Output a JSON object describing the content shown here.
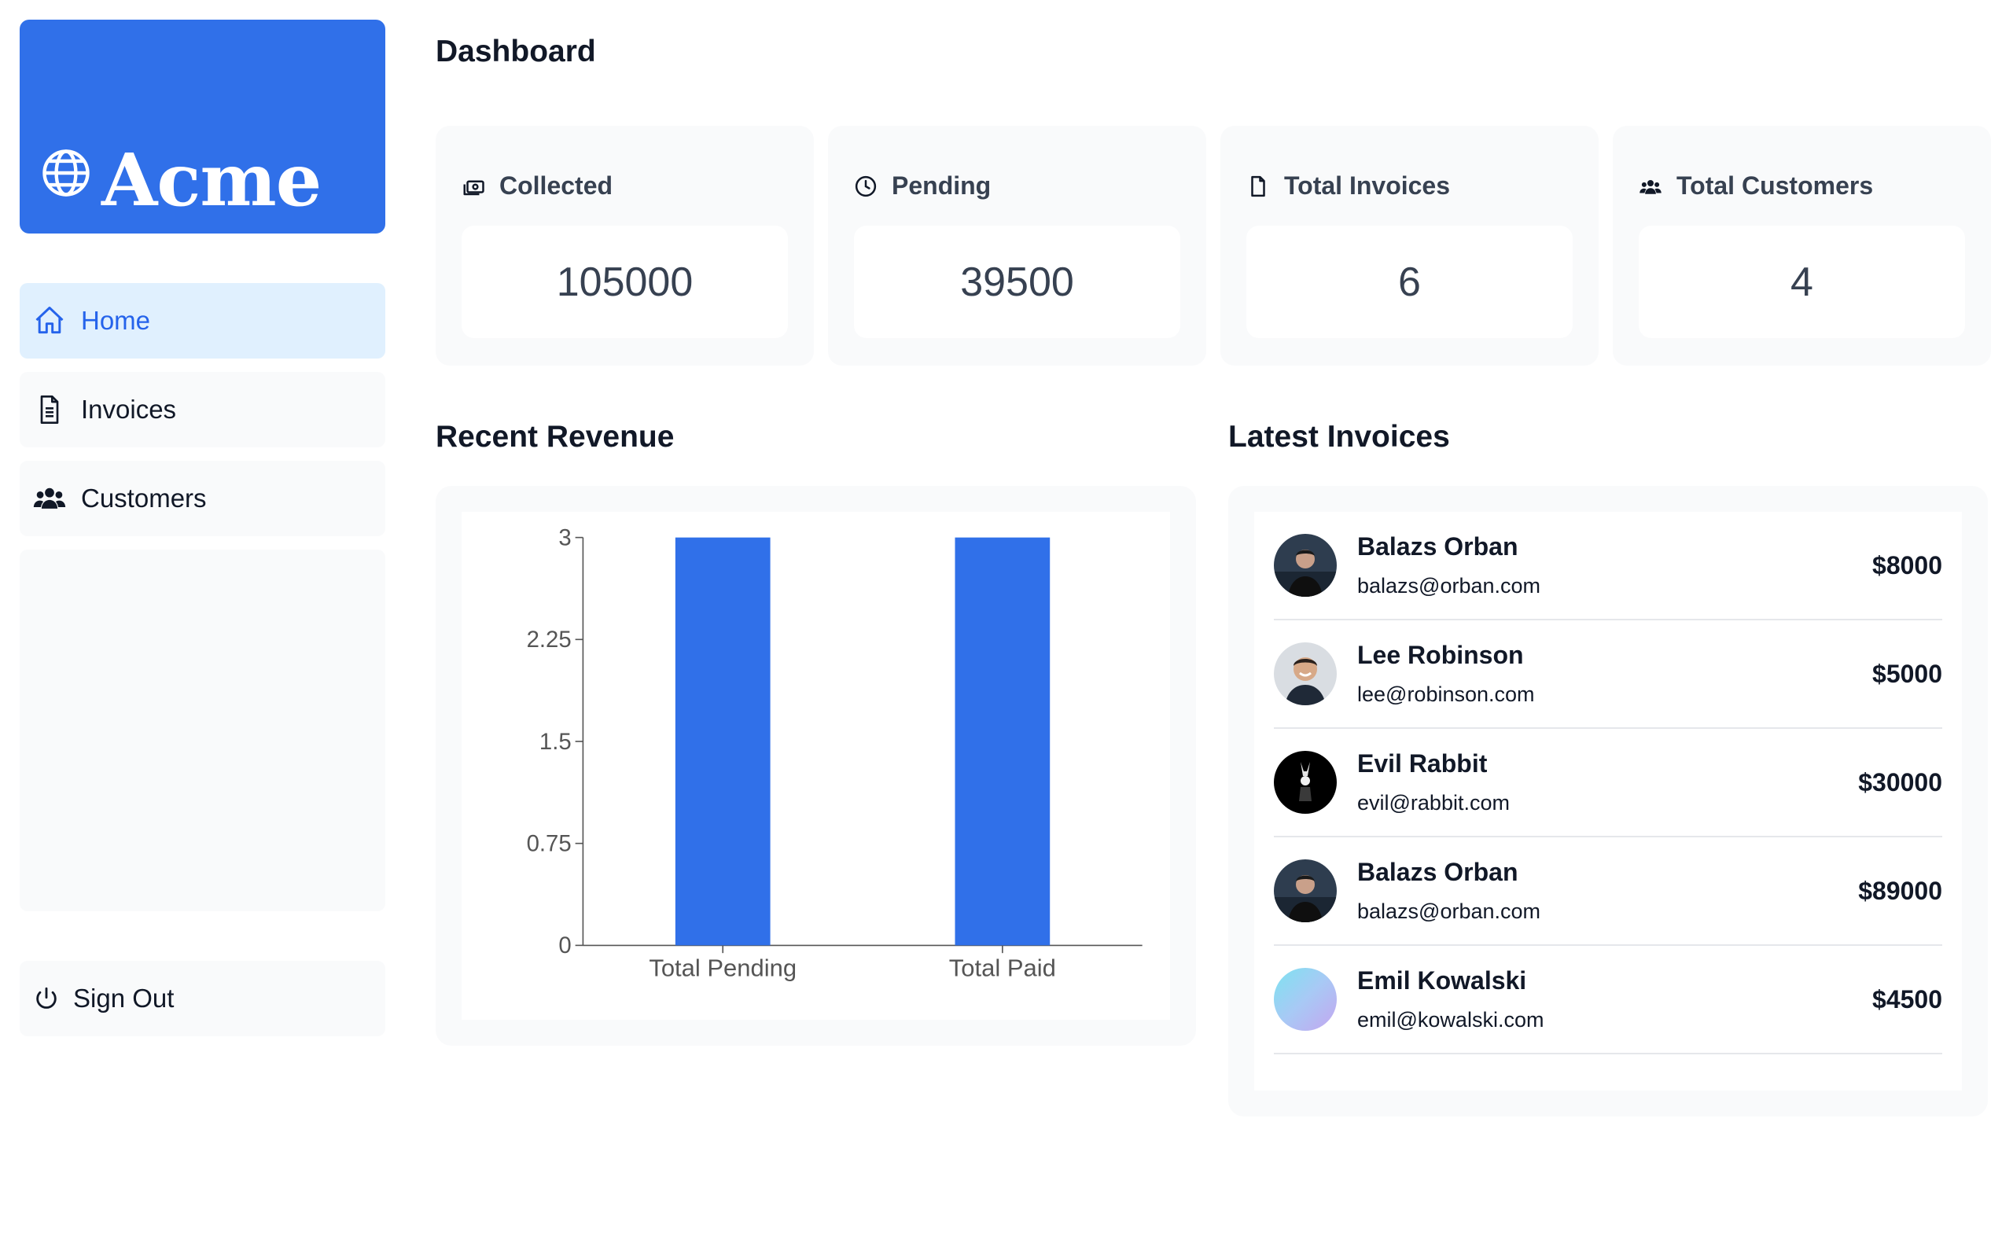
{
  "brand": {
    "name": "Acme"
  },
  "sidebar": {
    "items": [
      {
        "label": "Home",
        "icon": "home-icon",
        "active": true
      },
      {
        "label": "Invoices",
        "icon": "document-icon",
        "active": false
      },
      {
        "label": "Customers",
        "icon": "users-icon",
        "active": false
      }
    ],
    "sign_out": "Sign Out"
  },
  "main": {
    "title": "Dashboard",
    "cards": [
      {
        "label": "Collected",
        "value": "105000",
        "icon": "banknotes-icon"
      },
      {
        "label": "Pending",
        "value": "39500",
        "icon": "clock-icon"
      },
      {
        "label": "Total Invoices",
        "value": "6",
        "icon": "document-icon"
      },
      {
        "label": "Total Customers",
        "value": "4",
        "icon": "users-icon"
      }
    ],
    "revenue_title": "Recent Revenue",
    "invoices_title": "Latest Invoices",
    "invoices": [
      {
        "name": "Balazs Orban",
        "email": "balazs@orban.com",
        "amount": "$8000",
        "avatar": "dark"
      },
      {
        "name": "Lee Robinson",
        "email": "lee@robinson.com",
        "amount": "$5000",
        "avatar": "smile"
      },
      {
        "name": "Evil Rabbit",
        "email": "evil@rabbit.com",
        "amount": "$30000",
        "avatar": "rabbit"
      },
      {
        "name": "Balazs Orban",
        "email": "balazs@orban.com",
        "amount": "$89000",
        "avatar": "dark"
      },
      {
        "name": "Emil Kowalski",
        "email": "emil@kowalski.com",
        "amount": "$4500",
        "avatar": "gradient"
      }
    ]
  },
  "colors": {
    "accent": "#3070e9",
    "active_bg": "#e0f0fe",
    "panel_bg": "#f9fafb"
  },
  "chart_data": {
    "type": "bar",
    "categories": [
      "Total Pending",
      "Total Paid"
    ],
    "values": [
      3,
      3
    ],
    "yticks": [
      "0",
      "0.75",
      "1.5",
      "2.25",
      "3"
    ],
    "ylim": [
      0,
      3
    ],
    "grid": false
  }
}
